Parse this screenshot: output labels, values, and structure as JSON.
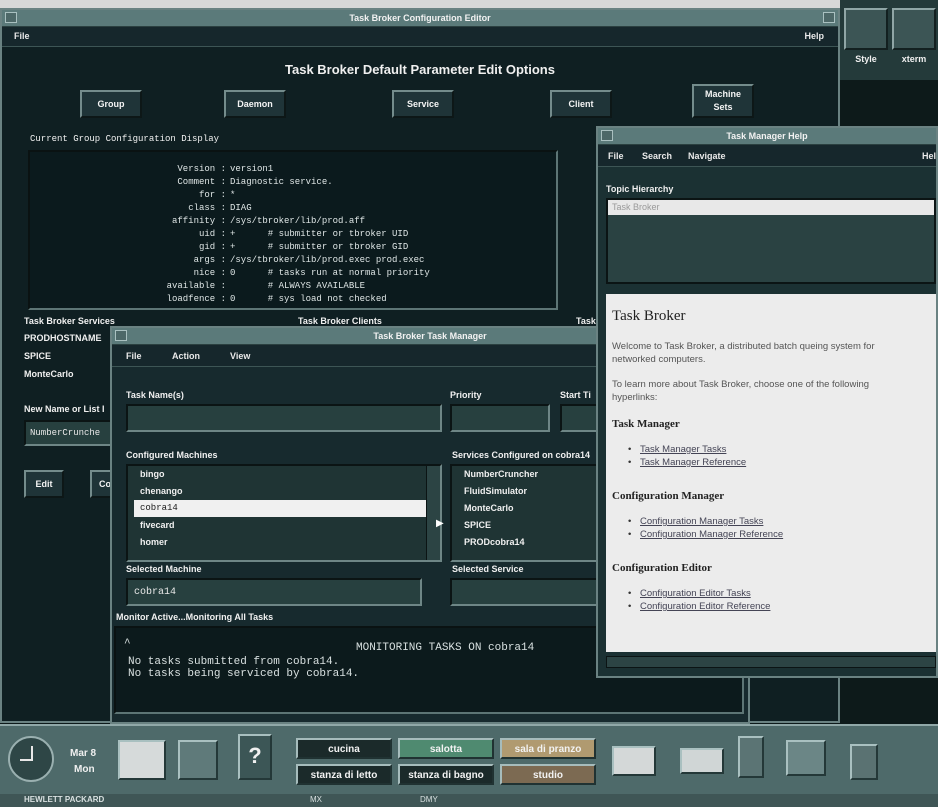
{
  "config_editor": {
    "title": "Task Broker Configuration Editor",
    "menu": {
      "file": "File",
      "help": "Help"
    },
    "heading": "Task Broker Default Parameter Edit Options",
    "tabs": {
      "group": "Group",
      "daemon": "Daemon",
      "service": "Service",
      "client": "Client",
      "machine_sets_1": "Machine",
      "machine_sets_2": "Sets"
    },
    "display_label": "Current Group Configuration Display",
    "display_rows": [
      {
        "key": "Version :",
        "value": "version1"
      },
      {
        "key": "Comment :",
        "value": "Diagnostic service."
      },
      {
        "key": "for :",
        "value": "*"
      },
      {
        "key": "class :",
        "value": "DIAG"
      },
      {
        "key": "affinity :",
        "value": "/sys/tbroker/lib/prod.aff"
      },
      {
        "key": "uid :",
        "value": "+      # submitter or tbroker UID"
      },
      {
        "key": "gid :",
        "value": "+      # submitter or tbroker GID"
      },
      {
        "key": "args :",
        "value": "/sys/tbroker/lib/prod.exec prod.exec"
      },
      {
        "key": "nice :",
        "value": "0      # tasks run at normal priority"
      },
      {
        "key": "available :",
        "value": "       # ALWAYS AVAILABLE"
      },
      {
        "key": "loadfence :",
        "value": "0      # sys load not checked"
      }
    ],
    "services_label": "Task Broker Services",
    "services": [
      "PRODHOSTNAME",
      "SPICE",
      "MonteCarlo"
    ],
    "clients_label": "Task Broker Clients",
    "task_label": "Task",
    "new_name_label": "New Name or List I",
    "new_name_value": "NumberCrunche",
    "edit_button": "Edit",
    "copy_button": "Co"
  },
  "side_strip": {
    "style_label": "Style",
    "xterm_label": "xterm"
  },
  "task_manager": {
    "title": "Task Broker Task Manager",
    "menu": {
      "file": "File",
      "action": "Action",
      "view": "View"
    },
    "task_name_label": "Task Name(s)",
    "priority_label": "Priority",
    "start_time_label": "Start Ti",
    "machines_label": "Configured Machines",
    "machines": [
      "bingo",
      "chenango",
      "cobra14",
      "fivecard",
      "homer"
    ],
    "selected_machine_index": 2,
    "services_label": "Services Configured on cobra14",
    "services": [
      "NumberCruncher",
      "FluidSimulator",
      "MonteCarlo",
      "SPICE",
      "PRODcobra14"
    ],
    "selected_machine_label": "Selected Machine",
    "selected_machine_value": "cobra14",
    "selected_service_label": "Selected Service",
    "monitor_status": "Monitor Active...Monitoring All Tasks",
    "monitor_lines": [
      "MONITORING TASKS ON cobra14",
      "No tasks submitted from cobra14.",
      "No tasks being serviced by cobra14."
    ]
  },
  "help": {
    "title": "Task Manager Help",
    "menu": {
      "file": "File",
      "search": "Search",
      "navigate": "Navigate",
      "help": "Hel"
    },
    "topic_label": "Topic Hierarchy",
    "topic_value": "Task Broker",
    "heading": "Task Broker",
    "para1": "Welcome to Task Broker, a distributed batch queing system for networked computers.",
    "para2": "To learn more about Task Broker, choose one of the following hyperlinks:",
    "sections": [
      {
        "title": "Task Manager",
        "links": [
          "Task Manager Tasks",
          "Task Manager Reference"
        ]
      },
      {
        "title": "Configuration Manager",
        "links": [
          "Configuration Manager Tasks",
          "Configuration Manager Reference"
        ]
      },
      {
        "title": "Configuration Editor",
        "links": [
          "Configuration Editor Tasks",
          "Configuration Editor Reference"
        ]
      }
    ]
  },
  "dock": {
    "date_1": "Mar 8",
    "date_2": "Mon",
    "workspaces": [
      "cucina",
      "salotta",
      "sala di pranzo",
      "stanza di letto",
      "stanza di bagno",
      "studio"
    ],
    "active_workspace_colors": [
      "#1b2a2a",
      "#4f8a70",
      "#b09a70",
      "#1b2a2a",
      "#1b2a2a",
      "#7c6a52"
    ]
  },
  "bottom_strip": {
    "brand": "HEWLETT PACKARD",
    "mx_label": "MX",
    "dmy_label": "DMY"
  }
}
